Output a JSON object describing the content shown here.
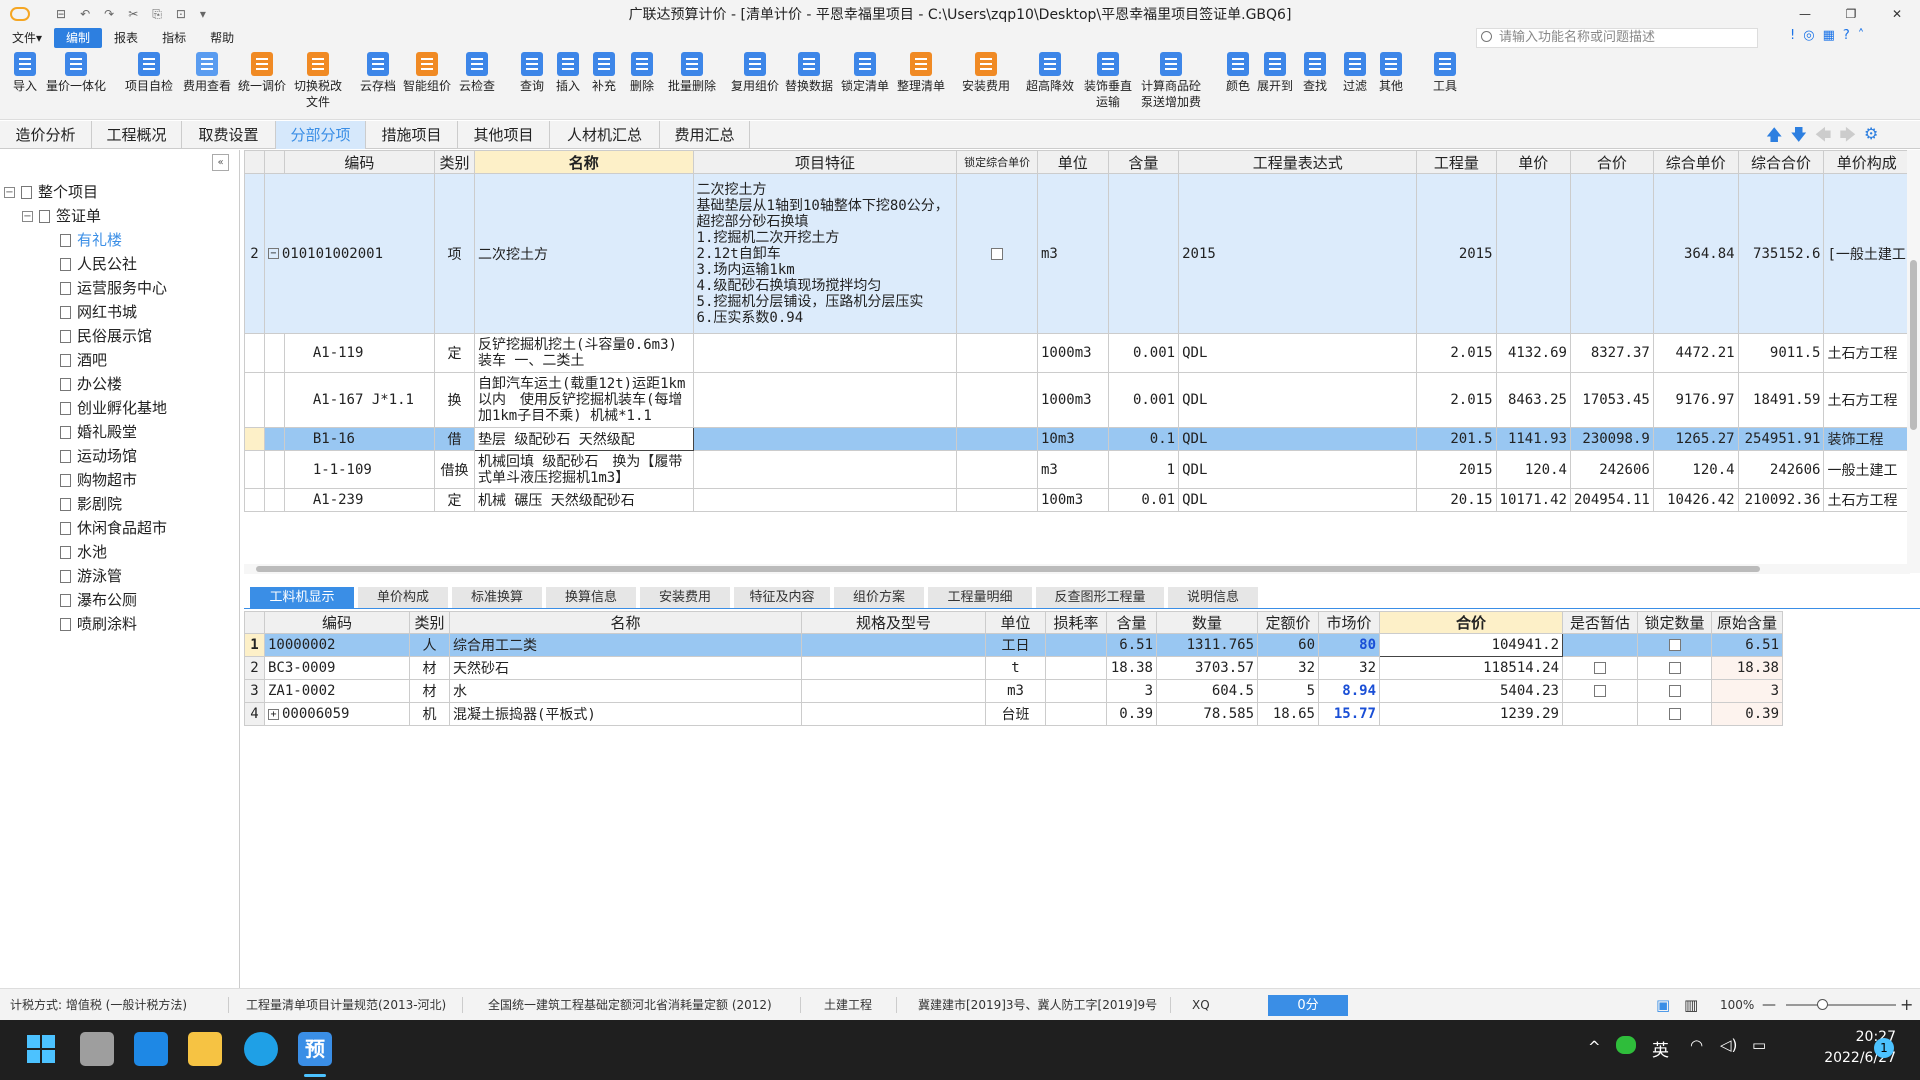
{
  "app": {
    "title": "广联达预算计价 - [清单计价 - 平恩幸福里项目 - C:\\Users\\zqp10\\Desktop\\平恩幸福里项目签证单.GBQ6]",
    "quick_access": [
      "⊟",
      "↶",
      "↷",
      "✂",
      "⎘",
      "⊡",
      "▾"
    ]
  },
  "menu": [
    "文件▾",
    "编制",
    "报表",
    "指标",
    "帮助"
  ],
  "search": {
    "placeholder": "请输入功能名称或问题描述"
  },
  "header_icons": [
    "!",
    "◎",
    "▦",
    "?",
    "˄"
  ],
  "window": {
    "minimize": "—",
    "restore": "❐",
    "close": "✕"
  },
  "toolbar": [
    "导入",
    "量价一体化",
    "项目自检",
    "费用查看",
    "统一调价",
    "切换税改\n文件",
    "云存档",
    "智能组价",
    "云检查",
    "查询",
    "插入",
    "补充",
    "删除",
    "批量删除",
    "复用组价",
    "替换数据",
    "锁定清单",
    "整理清单",
    "安装费用",
    "超高降效",
    "装饰垂直\n运输",
    "计算商品砼\n泵送增加费",
    "颜色",
    "展开到",
    "查找",
    "过滤",
    "其他",
    "工具"
  ],
  "tabs": [
    "造价分析",
    "工程概况",
    "取费设置",
    "分部分项",
    "措施项目",
    "其他项目",
    "人材机汇总",
    "费用汇总"
  ],
  "tab_arrows": [
    "🡅",
    "🡇",
    "🡄",
    "🡆",
    "⚙"
  ],
  "tree": {
    "collapse": "«",
    "root": "整个项目",
    "group": "签证单",
    "items": [
      "有礼楼",
      "人民公社",
      "运营服务中心",
      "网红书城",
      "民俗展示馆",
      "酒吧",
      "办公楼",
      "创业孵化基地",
      "婚礼殿堂",
      "运动场馆",
      "购物超市",
      "影剧院",
      "休闲食品超市",
      "水池",
      "游泳管",
      "瀑布公厕",
      "喷刷涂料"
    ]
  },
  "upper_headers": [
    "编码",
    "类别",
    "名称",
    "项目特征",
    "锁定综合单价",
    "单位",
    "含量",
    "工程量表达式",
    "工程量",
    "单价",
    "合价",
    "综合单价",
    "综合合价",
    "单价构成"
  ],
  "upper_rows": [
    {
      "no": "2",
      "code": "010101002001",
      "type": "项",
      "name": "二次挖土方",
      "feature": "二次挖土方\n基础垫层从1轴到10轴整体下挖80公分，超挖部分砂石换填\n1.挖掘机二次开挖土方\n2.12t自卸车\n3.场内运输1km\n4.级配砂石换填现场搅拌均匀\n5.挖掘机分层铺设，压路机分层压实\n6.压实系数0.94",
      "unit": "m3",
      "qty": "",
      "expr": "2015",
      "amount": "2015",
      "price": "",
      "total": "",
      "uprice": "364.84",
      "utotal": "735152.6",
      "comp": "[一般土建工"
    },
    {
      "no": "",
      "code": "A1-119",
      "type": "定",
      "name": "反铲挖掘机挖土(斗容量0.6m3) 装车 一、二类土",
      "feature": "",
      "unit": "1000m3",
      "qty": "0.001",
      "expr": "QDL",
      "amount": "2.015",
      "price": "4132.69",
      "total": "8327.37",
      "uprice": "4472.21",
      "utotal": "9011.5",
      "comp": "土石方工程"
    },
    {
      "no": "",
      "code": "A1-167 J*1.1",
      "type": "换",
      "name": "自卸汽车运土(载重12t)运距1km以内　使用反铲挖掘机装车(每增加1km子目不乘) 机械*1.1",
      "feature": "",
      "unit": "1000m3",
      "qty": "0.001",
      "expr": "QDL",
      "amount": "2.015",
      "price": "8463.25",
      "total": "17053.45",
      "uprice": "9176.97",
      "utotal": "18491.59",
      "comp": "土石方工程"
    },
    {
      "no": "",
      "code": "B1-16",
      "type": "借",
      "name": "垫层 级配砂石 天然级配",
      "feature": "",
      "unit": "10m3",
      "qty": "0.1",
      "expr": "QDL",
      "amount": "201.5",
      "price": "1141.93",
      "total": "230098.9",
      "uprice": "1265.27",
      "utotal": "254951.91",
      "comp": "装饰工程"
    },
    {
      "no": "",
      "code": "1-1-109",
      "type": "借换",
      "name": "机械回填 级配砂石　换为【履带式单斗液压挖掘机1m3】",
      "feature": "",
      "unit": "m3",
      "qty": "1",
      "expr": "QDL",
      "amount": "2015",
      "price": "120.4",
      "total": "242606",
      "uprice": "120.4",
      "utotal": "242606",
      "comp": "一般土建工"
    },
    {
      "no": "",
      "code": "A1-239",
      "type": "定",
      "name": "机械 碾压 天然级配砂石",
      "feature": "",
      "unit": "100m3",
      "qty": "0.01",
      "expr": "QDL",
      "amount": "20.15",
      "price": "10171.42",
      "total": "204954.11",
      "uprice": "10426.42",
      "utotal": "210092.36",
      "comp": "土石方工程"
    }
  ],
  "bottom_tabs": [
    "工料机显示",
    "单价构成",
    "标准换算",
    "换算信息",
    "安装费用",
    "特征及内容",
    "组价方案",
    "工程量明细",
    "反查图形工程量",
    "说明信息"
  ],
  "lower_headers": [
    "编码",
    "类别",
    "名称",
    "规格及型号",
    "单位",
    "损耗率",
    "含量",
    "数量",
    "定额价",
    "市场价",
    "合价",
    "是否暂估",
    "锁定数量",
    "原始含量"
  ],
  "lower_rows": [
    {
      "no": "1",
      "code": "10000002",
      "type": "人",
      "name": "综合用工二类",
      "spec": "",
      "unit": "工日",
      "loss": "",
      "qty": "6.51",
      "amount": "1311.765",
      "base": "60",
      "market": "80",
      "total": "104941.2",
      "orig": "6.51"
    },
    {
      "no": "2",
      "code": "BC3-0009",
      "type": "材",
      "name": "天然砂石",
      "spec": "",
      "unit": "t",
      "loss": "",
      "qty": "18.38",
      "amount": "3703.57",
      "base": "32",
      "market": "32",
      "total": "118514.24",
      "orig": "18.38"
    },
    {
      "no": "3",
      "code": "ZA1-0002",
      "type": "材",
      "name": "水",
      "spec": "",
      "unit": "m3",
      "loss": "",
      "qty": "3",
      "amount": "604.5",
      "base": "5",
      "market": "8.94",
      "total": "5404.23",
      "orig": "3"
    },
    {
      "no": "4",
      "code": "00006059",
      "type": "机",
      "name": "混凝土振捣器(平板式)",
      "spec": "",
      "unit": "台班",
      "loss": "",
      "qty": "0.39",
      "amount": "78.585",
      "base": "18.65",
      "market": "15.77",
      "total": "1239.29",
      "orig": "0.39"
    }
  ],
  "status": {
    "tax": "计税方式: 增值税 (一般计税方法)",
    "std": "工程量清单项目计量规范(2013-河北)",
    "quota": "全国统一建筑工程基础定额河北省消耗量定额 (2012)",
    "major": "土建工程",
    "doc": "冀建建市[2019]3号、冀人防工字[2019]9号",
    "xq": "XQ",
    "score": "0分",
    "zoom": "100%",
    "zoom_minus": "—",
    "zoom_plus": "+"
  },
  "taskbar": {
    "time": "20:27",
    "date": "2022/6/27",
    "ime": "英",
    "notif": "1",
    "up": "^",
    "wifi": "◠",
    "vol": "◁)",
    "batt": "▭"
  },
  "colors": {
    "accent": "#3a8ee6",
    "selected_row": "#99c7f2",
    "parent_row": "#dcebfb",
    "header_highlight": "#fdf0c8"
  }
}
